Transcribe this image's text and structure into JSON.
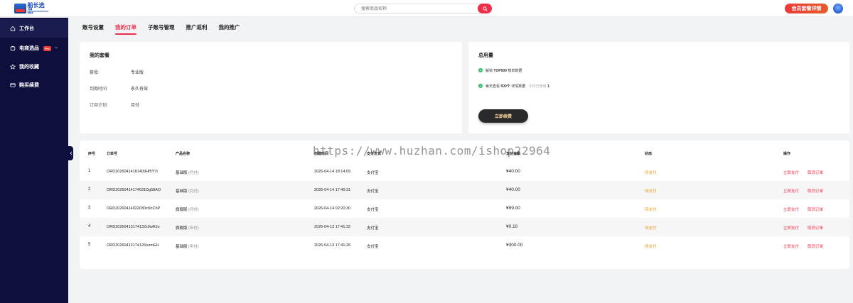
{
  "header": {
    "logo_text": "船长选品",
    "search_placeholder": "搜索商品名称",
    "vip_button": "会员套餐详情"
  },
  "sidebar": {
    "items": [
      {
        "label": "工作台",
        "icon": "home-icon",
        "active": true
      },
      {
        "label": "电商选品",
        "icon": "cart-icon",
        "badge": "Pro"
      },
      {
        "label": "我的收藏",
        "icon": "star-icon"
      },
      {
        "label": "购买续费",
        "icon": "card-icon"
      }
    ]
  },
  "tabs": [
    "账号设置",
    "我的订单",
    "子账号管理",
    "推广返利",
    "我的推广"
  ],
  "active_tab": "我的订单",
  "plan_card": {
    "title": "我的套餐",
    "rows": [
      {
        "label": "套餐:",
        "value": "专业版"
      },
      {
        "label": "到期时间:",
        "value": "永久有效"
      },
      {
        "label": "订阅计划:",
        "value": "月付"
      }
    ]
  },
  "usage_card": {
    "title": "总用量",
    "feature1_prefix": "解锁",
    "feature1_bold": "TOP500",
    "feature1_suffix": "榜单数据",
    "feature2_prefix": "每天查看",
    "feature2_bold": "500个",
    "feature2_suffix": "详情数据",
    "feature2_muted_label": "今日已使用",
    "feature2_muted_value": "1",
    "renew_button": "立即续费"
  },
  "orders": {
    "columns": {
      "no": "序号",
      "order_id": "订单号",
      "product": "产品名称",
      "created": "创建时间",
      "method": "支付方式",
      "amount": "支付金额",
      "status": "状态",
      "actions": "操作"
    },
    "rows": [
      {
        "no": "1",
        "order_id": "ORD20260414181409Hf5Y7t",
        "product": "基础版",
        "period": "(月付)",
        "created": "2026-04-14 18:14:09",
        "method": "支付宝",
        "amount": "¥40.00",
        "status": "待支付",
        "pay": "立即支付",
        "cancel": "取消订单"
      },
      {
        "no": "2",
        "order_id": "ORD20260414174031Dg58AO",
        "product": "基础版",
        "period": "(月付)",
        "created": "2026-04-14 17:40:31",
        "method": "支付宝",
        "amount": "¥40.00",
        "status": "待支付",
        "pay": "立即支付",
        "cancel": "取消订单"
      },
      {
        "no": "3",
        "order_id": "ORD20260414022030xNcChP",
        "product": "旗舰版",
        "period": "(月付)",
        "created": "2026-04-14 02:20:30",
        "method": "支付宝",
        "amount": "¥99.00",
        "status": "待支付",
        "pay": "立即支付",
        "cancel": "取消订单"
      },
      {
        "no": "4",
        "order_id": "ORD20260413174132x0wRJu",
        "product": "旗舰版",
        "period": "(年付)",
        "created": "2026-04-13 17:41:32",
        "method": "支付宝",
        "amount": "¥0.10",
        "status": "待支付",
        "pay": "立即支付",
        "cancel": "取消订单"
      },
      {
        "no": "5",
        "order_id": "ORD20260413174126turmEH",
        "product": "基础版",
        "period": "(年付)",
        "created": "2026-04-13 17:41:26",
        "method": "支付宝",
        "amount": "¥300.00",
        "status": "待支付",
        "pay": "立即支付",
        "cancel": "取消订单"
      }
    ]
  },
  "watermark": "https://www.huzhan.com/ishop22964",
  "colors": {
    "accent": "#ec2f4b",
    "sidebar_bg": "#0f0f3d",
    "status_pending": "#e89a1c",
    "check_green": "#2dbf6a"
  }
}
